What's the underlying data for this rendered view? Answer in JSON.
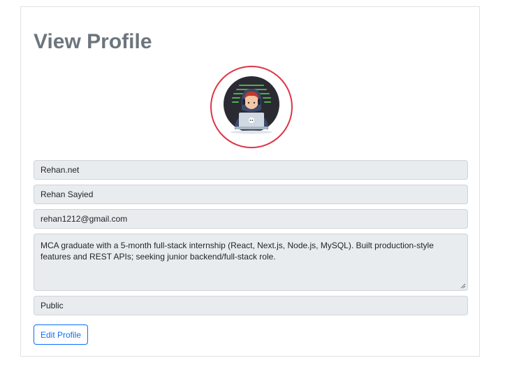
{
  "page": {
    "title": "View Profile"
  },
  "profile": {
    "avatar_alt": "developer avatar",
    "username": "Rehan.net",
    "full_name": "Rehan Sayied",
    "email": "rehan1212@gmail.com",
    "bio": "MCA graduate with a 5-month full-stack internship (React, Next.js, Node.js, MySQL). Built production-style features and REST APIs; seeking junior backend/full-stack role.",
    "visibility": "Public"
  },
  "actions": {
    "edit_label": "Edit Profile"
  },
  "colors": {
    "title": "#6c757d",
    "avatar_border": "#dc3545",
    "field_bg": "#e9ecef",
    "primary": "#0d6efd"
  }
}
